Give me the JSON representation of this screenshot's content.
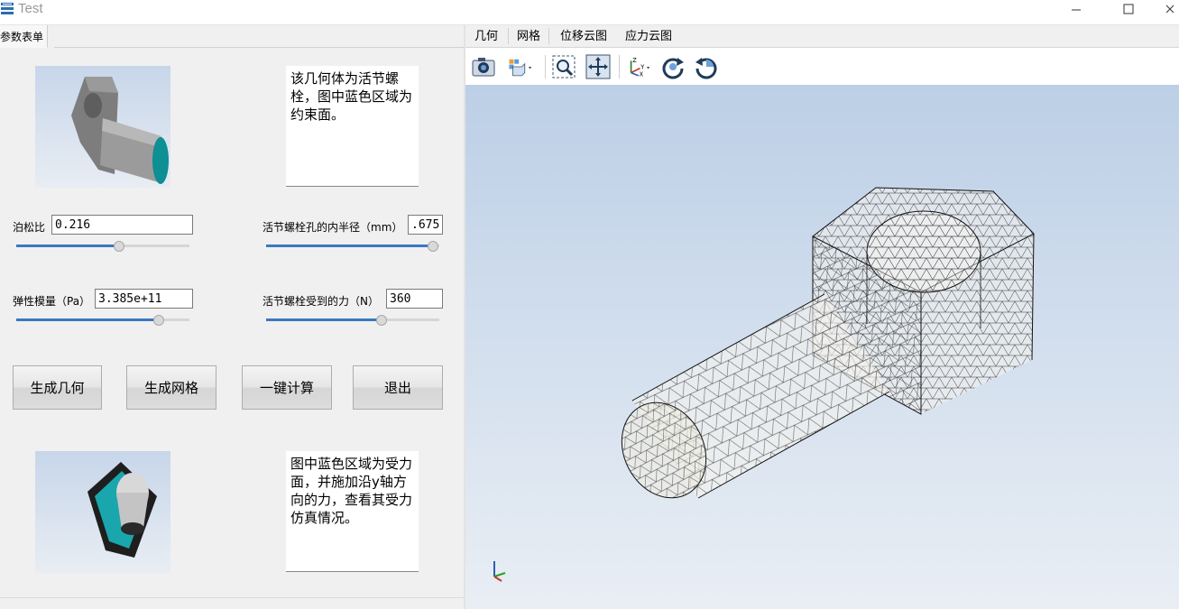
{
  "window": {
    "title": "Test"
  },
  "left_tab": {
    "label": "参数表单"
  },
  "geometry_description": "该几何体为活节螺栓，图中蓝色区域为约束面。",
  "load_description": "图中蓝色区域为受力面，并施加沿y轴方向的力，查看其受力仿真情况。",
  "params": {
    "poisson": {
      "label": "泊松比",
      "value": "0.216",
      "slider": 0.59
    },
    "inner_radius": {
      "label": "活节螺栓孔的内半径（mm）",
      "value": ".675",
      "slider": 0.96
    },
    "elastic_modulus": {
      "label": "弹性模量（Pa）",
      "value": "3.385e+11",
      "slider": 0.82
    },
    "force": {
      "label": "活节螺栓受到的力（N）",
      "value": "360",
      "slider": 0.66
    }
  },
  "buttons": {
    "gen_geometry": "生成几何",
    "gen_mesh": "生成网格",
    "compute": "一键计算",
    "exit": "退出"
  },
  "menu": [
    "几何",
    "网格",
    "位移云图",
    "应力云图"
  ],
  "toolbar_icons": [
    "camera-icon",
    "view-cube-icon",
    "zoom-fit-icon",
    "pan-icon",
    "axes-icon",
    "rotate-cw-icon",
    "rotate-ccw-icon"
  ],
  "colors": {
    "accent": "#3b78c1",
    "constraint_face": "#0d8f94",
    "viewport_top": "#bccfe6",
    "viewport_bottom": "#e9eef4"
  }
}
